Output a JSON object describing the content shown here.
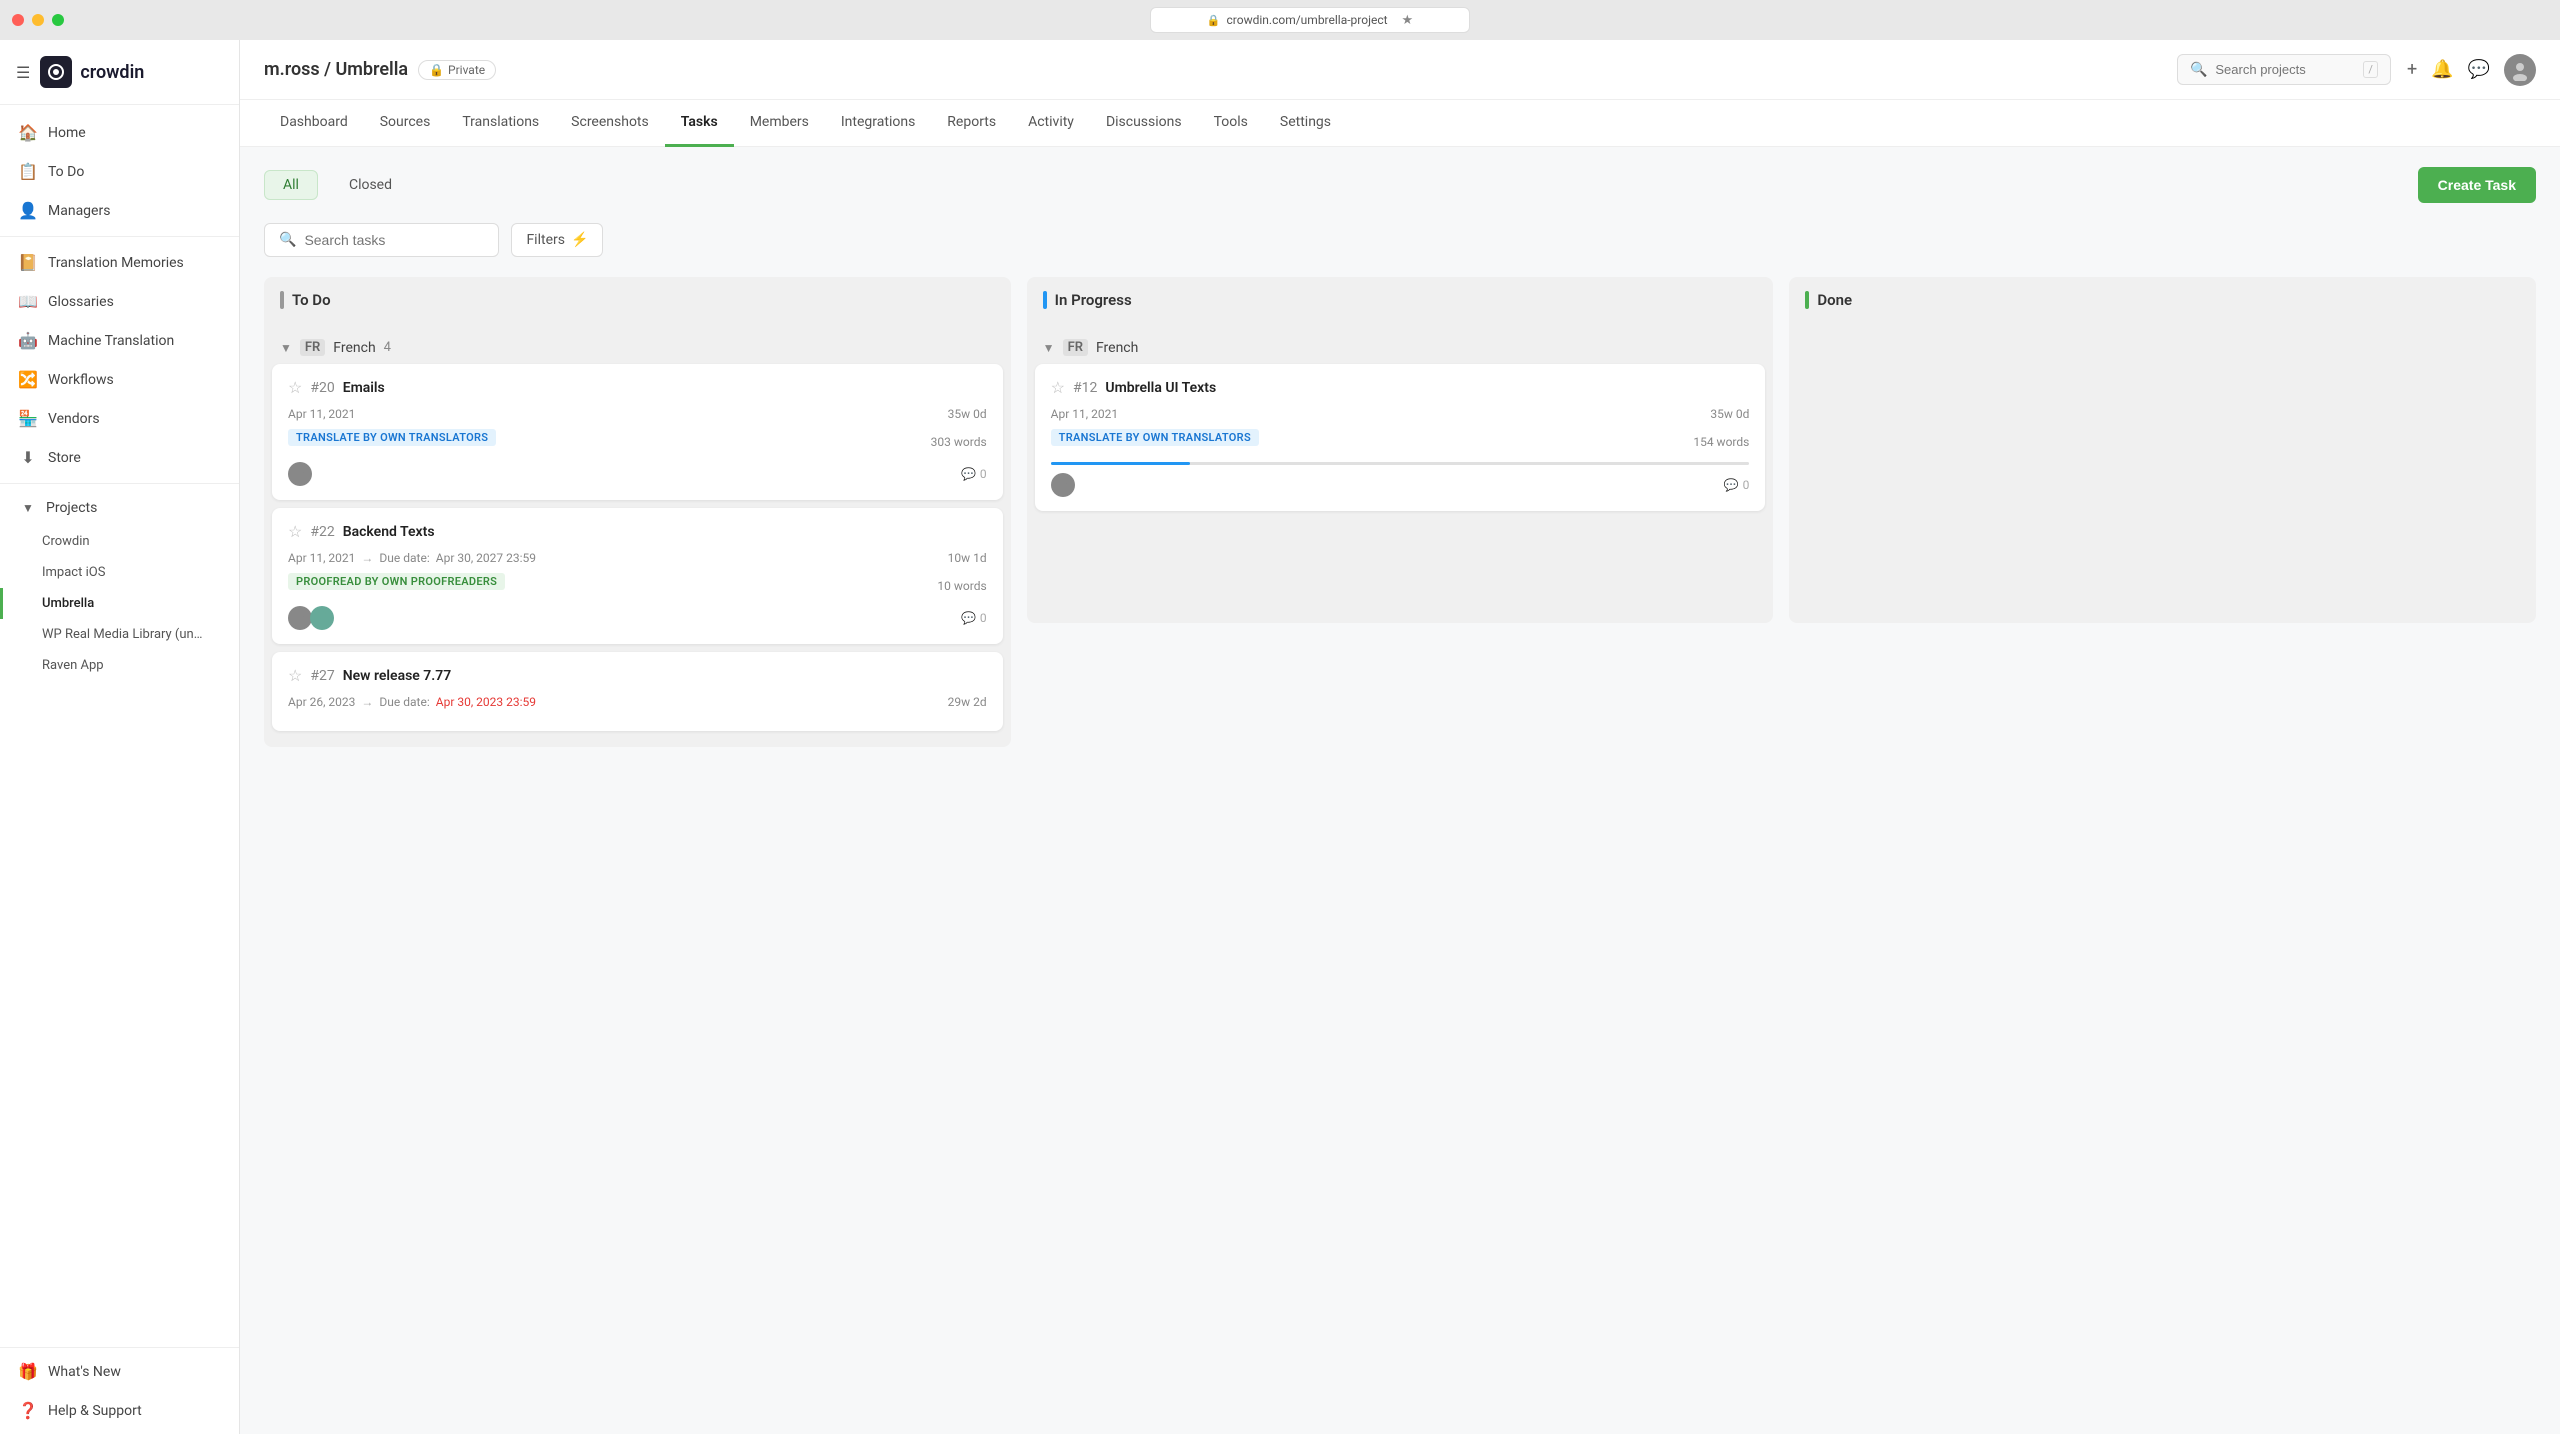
{
  "browser": {
    "url": "crowdin.com/umbrella-project",
    "traffic_lights": [
      "red",
      "yellow",
      "green"
    ]
  },
  "header": {
    "project_path": "m.ross / Umbrella",
    "private_label": "Private",
    "search_placeholder": "Search projects",
    "search_shortcut": "/",
    "add_icon": "+",
    "bell_icon": "🔔",
    "chat_icon": "💬"
  },
  "sidebar": {
    "logo_text": "crowdin",
    "nav_items": [
      {
        "id": "home",
        "icon": "🏠",
        "label": "Home"
      },
      {
        "id": "todo",
        "icon": "📋",
        "label": "To Do"
      },
      {
        "id": "managers",
        "icon": "👤",
        "label": "Managers"
      },
      {
        "id": "translation-memories",
        "icon": "📔",
        "label": "Translation Memories"
      },
      {
        "id": "glossaries",
        "icon": "📖",
        "label": "Glossaries"
      },
      {
        "id": "machine-translation",
        "icon": "🤖",
        "label": "Machine Translation"
      },
      {
        "id": "workflows",
        "icon": "🔀",
        "label": "Workflows"
      },
      {
        "id": "vendors",
        "icon": "🏪",
        "label": "Vendors"
      },
      {
        "id": "store",
        "icon": "⬇",
        "label": "Store"
      }
    ],
    "projects_label": "Projects",
    "projects": [
      {
        "id": "crowdin",
        "label": "Crowdin",
        "active": false
      },
      {
        "id": "impact-ios",
        "label": "Impact iOS",
        "active": false
      },
      {
        "id": "umbrella",
        "label": "Umbrella",
        "active": true
      },
      {
        "id": "wp-real-media",
        "label": "WP Real Media Library (un…",
        "active": false
      },
      {
        "id": "raven-app",
        "label": "Raven App",
        "active": false
      }
    ],
    "bottom_items": [
      {
        "id": "whats-new",
        "icon": "🎁",
        "label": "What's New"
      },
      {
        "id": "help-support",
        "icon": "❓",
        "label": "Help & Support"
      }
    ]
  },
  "tabs": [
    {
      "id": "dashboard",
      "label": "Dashboard"
    },
    {
      "id": "sources",
      "label": "Sources"
    },
    {
      "id": "translations",
      "label": "Translations"
    },
    {
      "id": "screenshots",
      "label": "Screenshots"
    },
    {
      "id": "tasks",
      "label": "Tasks",
      "active": true
    },
    {
      "id": "members",
      "label": "Members"
    },
    {
      "id": "integrations",
      "label": "Integrations"
    },
    {
      "id": "reports",
      "label": "Reports"
    },
    {
      "id": "activity",
      "label": "Activity"
    },
    {
      "id": "discussions",
      "label": "Discussions"
    },
    {
      "id": "tools",
      "label": "Tools"
    },
    {
      "id": "settings",
      "label": "Settings"
    }
  ],
  "tasks_page": {
    "filter_all_label": "All",
    "filter_closed_label": "Closed",
    "search_placeholder": "Search tasks",
    "filters_label": "Filters",
    "create_task_label": "Create Task",
    "columns": [
      {
        "id": "todo",
        "label": "To Do",
        "indicator": "gray"
      },
      {
        "id": "in-progress",
        "label": "In Progress",
        "indicator": "blue"
      },
      {
        "id": "done",
        "label": "Done",
        "indicator": "green"
      }
    ],
    "language_group": {
      "flag": "FR",
      "language": "French",
      "count": 4
    },
    "todo_cards": [
      {
        "id": 1,
        "starred": false,
        "task_number": "#20",
        "task_name": "Emails",
        "date": "Apr 11, 2021",
        "due_date": null,
        "due_overdue": false,
        "time_label": "35w 0d",
        "badge_type": "translate",
        "badge_label": "TRANSLATE BY OWN TRANSLATORS",
        "word_count": "303 words",
        "progress": 0,
        "assignees": 1,
        "comments": 0
      },
      {
        "id": 2,
        "starred": false,
        "task_number": "#22",
        "task_name": "Backend Texts",
        "date": "Apr 11, 2021",
        "due_date": "Apr 30, 2027 23:59",
        "due_overdue": false,
        "time_label": "10w 1d",
        "badge_type": "proofread",
        "badge_label": "PROOFREAD BY OWN PROOFREADERS",
        "word_count": "10 words",
        "progress": 0,
        "assignees": 2,
        "comments": 0
      },
      {
        "id": 3,
        "starred": false,
        "task_number": "#27",
        "task_name": "New release 7.77",
        "date": "Apr 26, 2023",
        "due_date": "Apr 30, 2023 23:59",
        "due_overdue": true,
        "time_label": "29w 2d",
        "badge_type": null,
        "badge_label": null,
        "word_count": null,
        "progress": 0,
        "assignees": 0,
        "comments": 0
      }
    ],
    "in_progress_cards": [
      {
        "id": 4,
        "starred": false,
        "task_number": "#12",
        "task_name": "Umbrella UI Texts",
        "date": "Apr 11, 2021",
        "due_date": null,
        "due_overdue": false,
        "time_label": "35w 0d",
        "badge_type": "translate",
        "badge_label": "TRANSLATE BY OWN TRANSLATORS",
        "word_count": "154 words",
        "progress": 20,
        "assignees": 1,
        "comments": 0
      }
    ]
  }
}
